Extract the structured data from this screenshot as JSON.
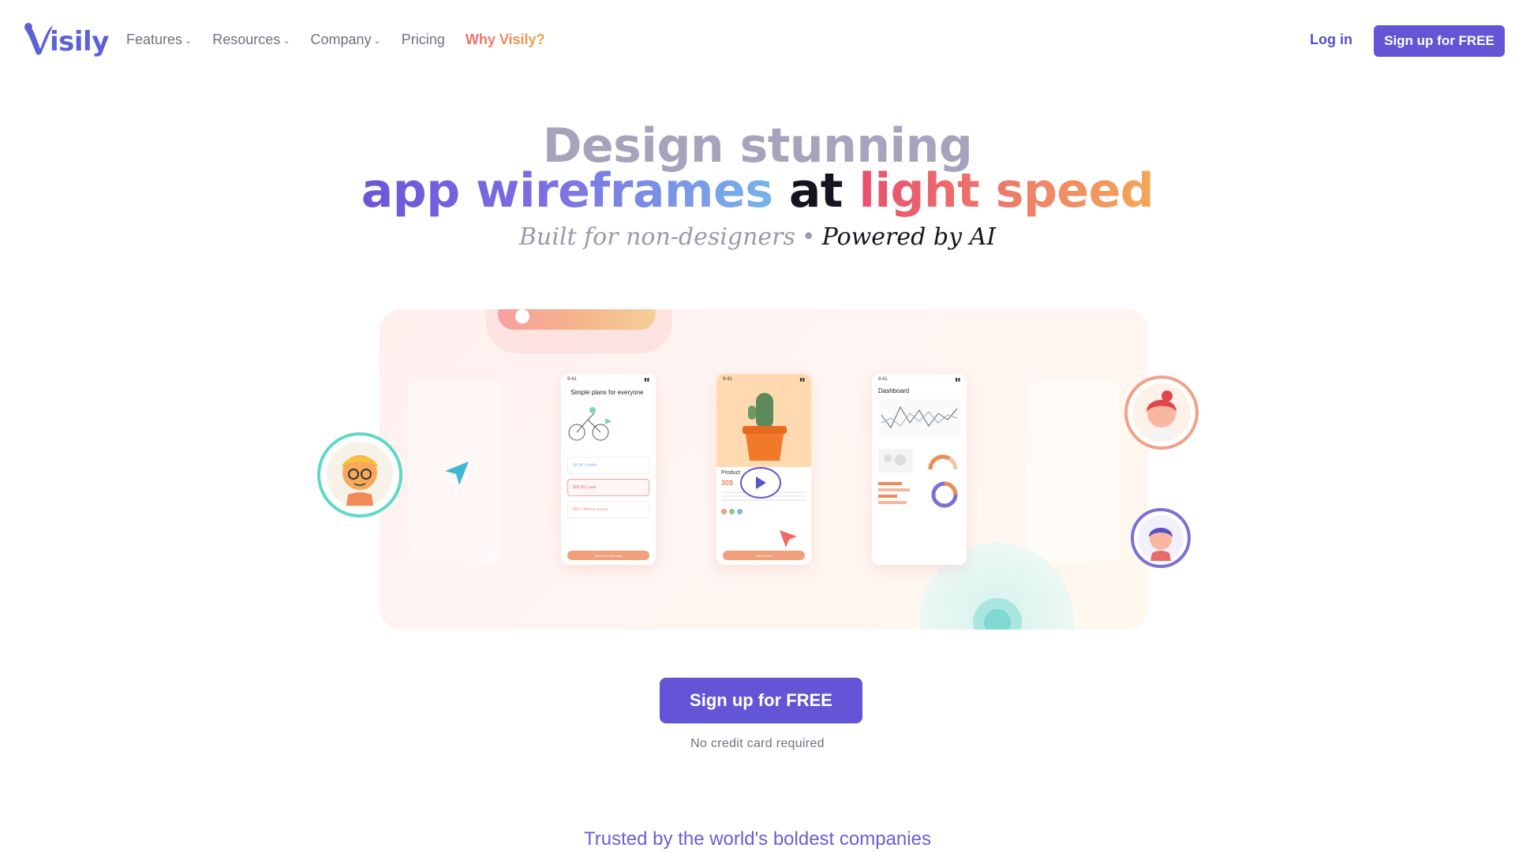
{
  "brand": {
    "name": "isily",
    "logo_icon": "visily-v-logo",
    "color": "#5b61d6"
  },
  "nav": {
    "items": [
      {
        "label": "Features",
        "icon": "chevron-down-icon"
      },
      {
        "label": "Resources",
        "icon": "chevron-down-icon"
      },
      {
        "label": "Company",
        "icon": "chevron-down-icon"
      },
      {
        "label": "Pricing"
      },
      {
        "label": "Why Visily?"
      }
    ],
    "login_label": "Log in",
    "signup_label": "Sign up for FREE"
  },
  "hero": {
    "line1": "Design stunning",
    "line2_part1": "app wireframes",
    "line2_part2": "at",
    "line2_part3": "light speed",
    "sub_part1": "Built for non-designers",
    "sub_dot": "•",
    "sub_part2": "Powered by AI"
  },
  "mockups": {
    "phone1": {
      "status": "9:41",
      "title": "Simple plans for everyone",
      "plans": [
        "$4.99 / month",
        "$39.99 / year",
        "$99 / lifetime access"
      ],
      "button": "Start free trial today"
    },
    "phone2": {
      "status": "9:41",
      "title": "Product",
      "price": "30$",
      "button": "Add to Cart"
    },
    "phone3": {
      "status": "9:41",
      "title": "Dashboard"
    }
  },
  "cta": {
    "label": "Sign up for FREE",
    "note": "No credit card required"
  },
  "trusted": {
    "heading": "Trusted by the world's boldest companies"
  },
  "colors": {
    "primary": "#6355d6",
    "accent_orange": "#e8705a",
    "heading_gray": "#a6a4bd"
  }
}
